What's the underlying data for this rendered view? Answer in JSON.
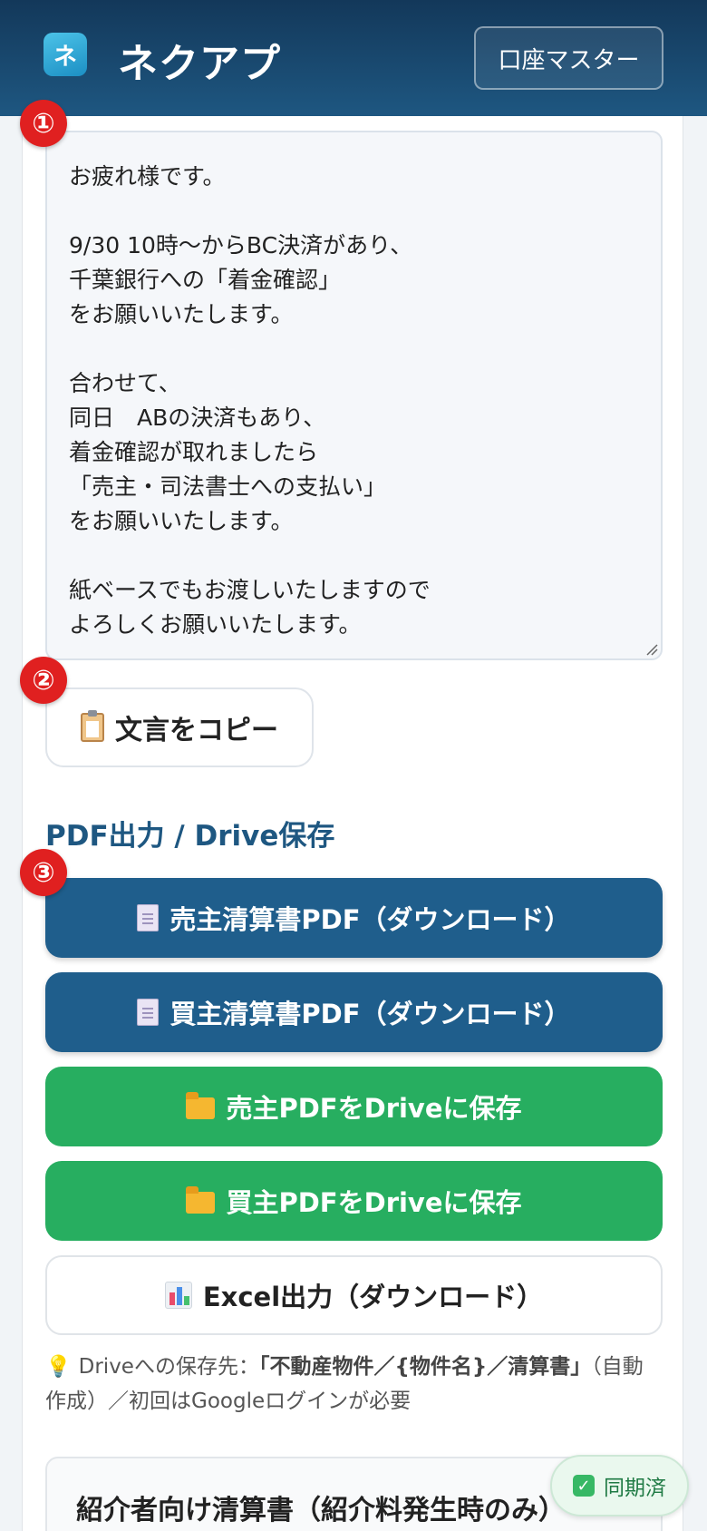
{
  "header": {
    "logo_glyph": "ネ",
    "title": "ネクアプ",
    "master_button": "口座マスター"
  },
  "steps": {
    "one": "①",
    "two": "②",
    "three": "③"
  },
  "message": {
    "text": "お疲れ様です。\n\n9/30 10時〜からBC決済があり、\n千葉銀行への「着金確認」\nをお願いいたします。\n\n合わせて、\n同日　ABの決済もあり、\n着金確認が取れましたら\n「売主・司法書士への支払い」\nをお願いいたします。\n\n紙ベースでもお渡しいたしますので\nよろしくお願いいたします。"
  },
  "copy_button": {
    "label": "文言をコピー",
    "icon": "clipboard-icon"
  },
  "pdf_section": {
    "title": "PDF出力 / Drive保存",
    "buttons": {
      "seller_pdf": "売主清算書PDF（ダウンロード）",
      "buyer_pdf": "買主清算書PDF（ダウンロード）",
      "seller_drive": "売主PDFをDriveに保存",
      "buyer_drive": "買主PDFをDriveに保存",
      "excel": "Excel出力（ダウンロード）"
    },
    "colors": {
      "blue": "#1f5e8c",
      "green": "#27ae60"
    }
  },
  "note": {
    "prefix": "Driveへの保存先：",
    "path": "「不動産物件／{物件名}／清算書」",
    "suffix": "（自動作成）／初回はGoogleログインが必要"
  },
  "referrer_section": {
    "title": "紹介者向け清算書（紹介料発生時のみ）"
  },
  "sync_status": {
    "label": "同期済"
  }
}
